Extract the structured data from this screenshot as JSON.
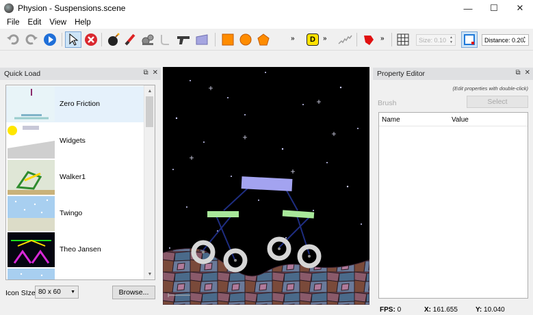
{
  "window": {
    "title": "Physion - Suspensions.scene",
    "minimize": "—",
    "maximize": "☐",
    "close": "✕"
  },
  "menu": [
    "File",
    "Edit",
    "View",
    "Help"
  ],
  "toolbar": {
    "d_label": "D",
    "size_label": "Size: 0.10",
    "distance_label": "Distance: 0.20",
    "more": "»"
  },
  "quick_load": {
    "title": "Quick Load",
    "items": [
      "Zero Friction",
      "Widgets",
      "Walker1",
      "Twingo",
      "Theo Jansen"
    ],
    "selected": "Zero Friction",
    "icon_size_label": "Icon SIze",
    "icon_size_value": "80 x 60",
    "browse_label": "Browse..."
  },
  "property_editor": {
    "title": "Property Editor",
    "hint": "(Edit properties with double-click)",
    "brush_label": "Brush",
    "select_label": "Select",
    "columns": [
      "Name",
      "Value"
    ]
  },
  "status": {
    "fps_label": "FPS:",
    "fps_value": "0",
    "x_label": "X:",
    "x_value": "161.655",
    "y_label": "Y:",
    "y_value": "10.040"
  },
  "colors": {
    "scene_bg": "#000000",
    "chassis": "#a3a3f0",
    "axle": "#a8e89a",
    "wheel": "#d6d6d6",
    "link": "#1e2d80",
    "accent_orange": "#ff8c00",
    "selection": "#e5f1fb"
  },
  "icons": {
    "undo": "undo-icon",
    "redo": "redo-icon",
    "play": "play-icon",
    "pointer": "pointer-icon",
    "delete": "delete-icon"
  }
}
